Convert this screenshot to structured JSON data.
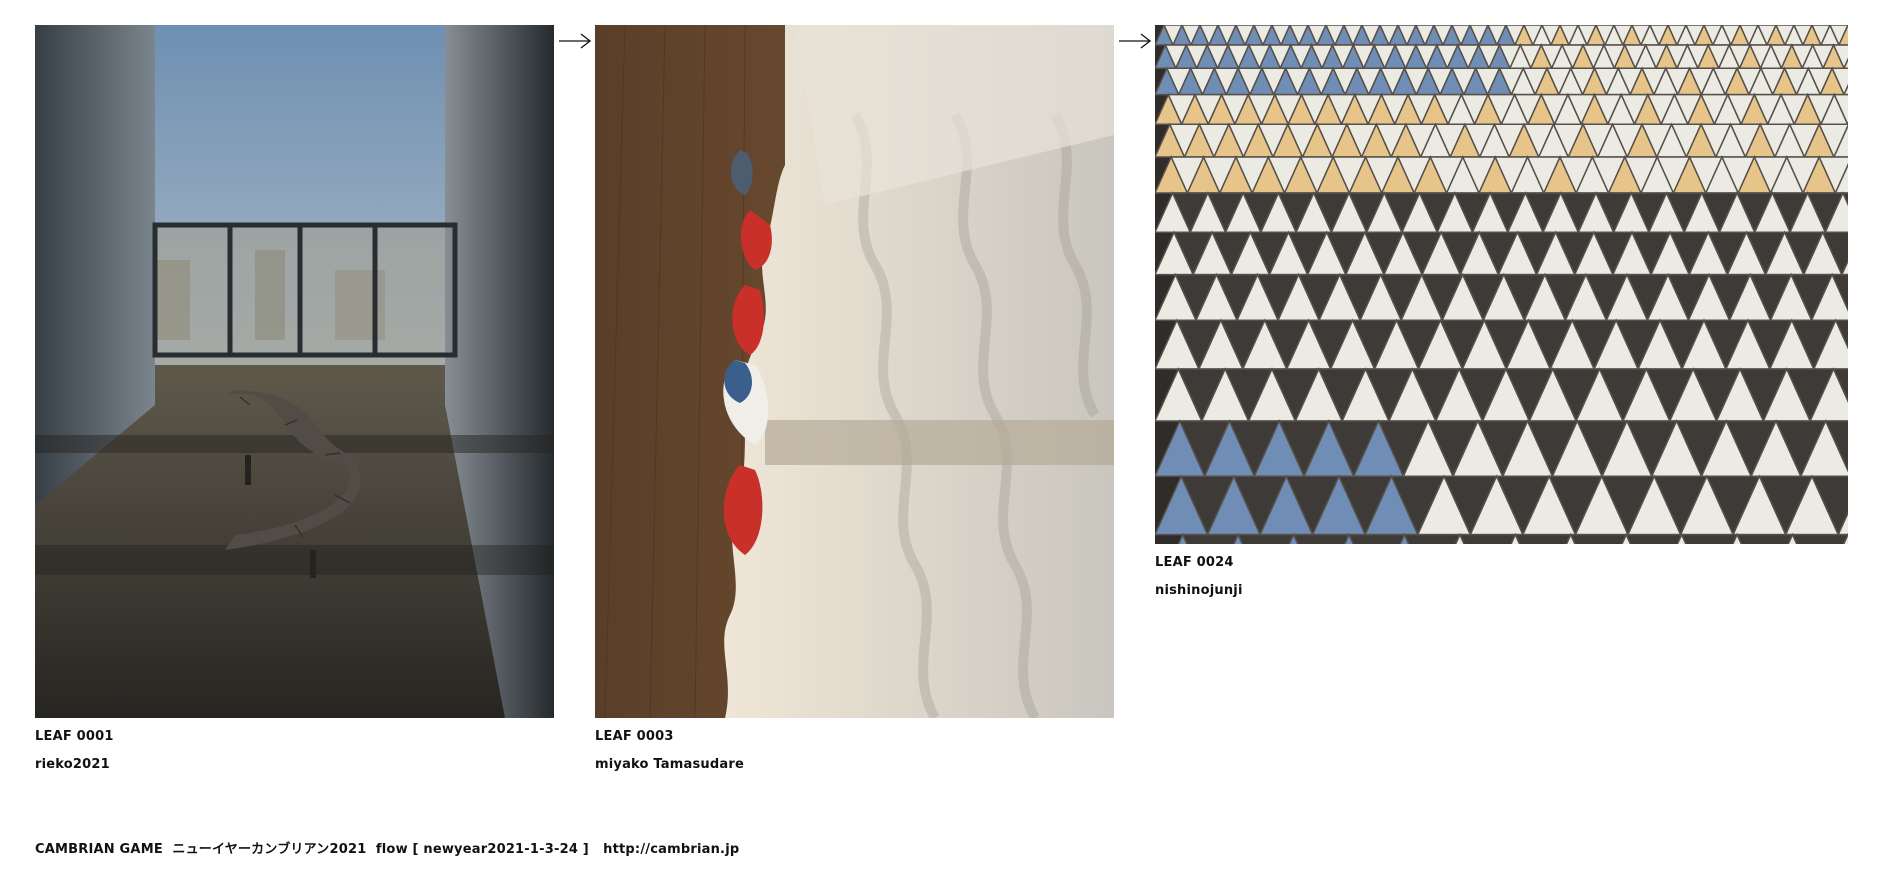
{
  "leaves": [
    {
      "title": "LEAF 0001",
      "author": "rieko2021",
      "image_desc": "photo-balcony-bench"
    },
    {
      "title": "LEAF 0003",
      "author": "miyako Tamasudare",
      "image_desc": "photo-gloves-curtain"
    },
    {
      "title": "LEAF 0024",
      "author": "nishinojunji",
      "image_desc": "photo-triangle-tiles"
    }
  ],
  "footer": {
    "site": "CAMBRIAN GAME",
    "event": "ニューイヤーカンブリアン2021",
    "flow": "flow [ newyear2021-1-3-24 ]",
    "url": "http://cambrian.jp"
  },
  "colors": {
    "tile_blue": "#6f8db5",
    "tile_yellow": "#e7c58a",
    "tile_white": "#ecebe3",
    "tile_dark": "#3d3a38",
    "glove_red": "#c9302a",
    "glove_blue": "#3b5f8c"
  }
}
